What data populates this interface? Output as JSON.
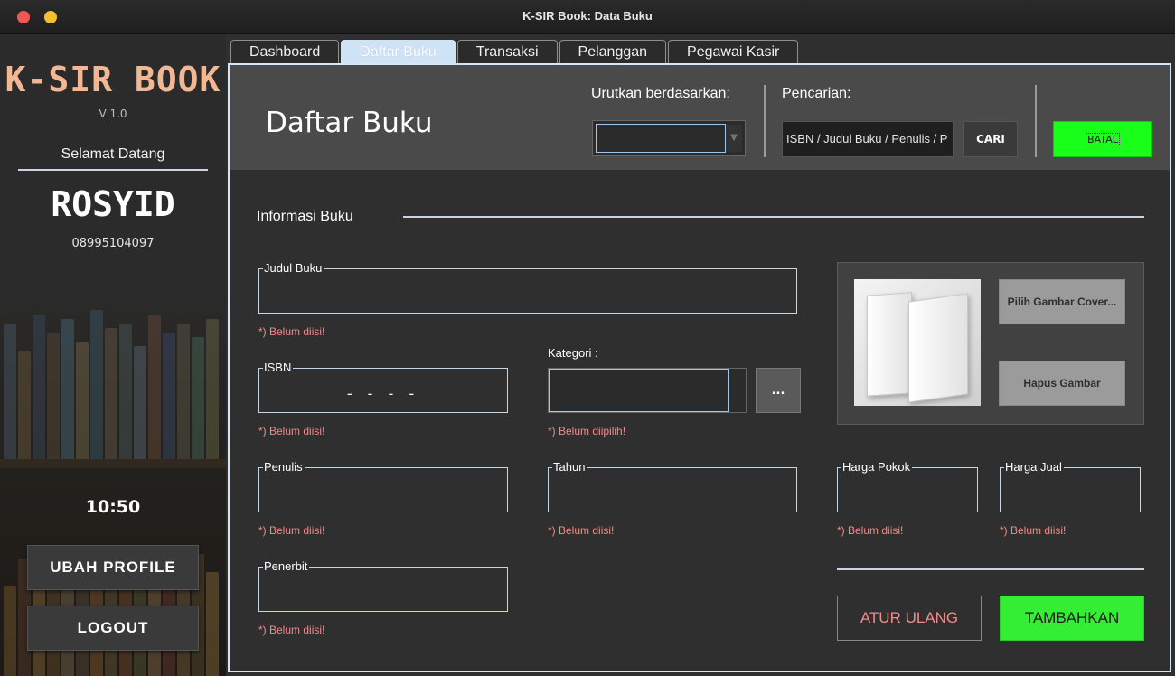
{
  "window": {
    "title": "K-SIR Book: Data Buku"
  },
  "sidebar": {
    "logo": "K-SIR BOOK",
    "version": "V 1.0",
    "welcome": "Selamat Datang",
    "username": "ROSYID",
    "phone": "08995104097",
    "clock": "10:50",
    "profile_button": "UBAH PROFILE",
    "logout_button": "LOGOUT"
  },
  "tabs": [
    {
      "label": "Dashboard",
      "active": false
    },
    {
      "label": "Daftar Buku",
      "active": true
    },
    {
      "label": "Transaksi",
      "active": false
    },
    {
      "label": "Pelanggan",
      "active": false
    },
    {
      "label": "Pegawai Kasir",
      "active": false
    }
  ],
  "header": {
    "title": "Daftar Buku",
    "sort_label": "Urutkan berdasarkan:",
    "sort_value": "",
    "search_label": "Pencarian:",
    "search_value": "ISBN / Judul Buku / Penulis / P",
    "search_button": "CARI",
    "cancel_button": "BATAL"
  },
  "form": {
    "section_title": "Informasi Buku",
    "judul": {
      "label": "Judul Buku",
      "value": "",
      "error": "*) Belum diisi!"
    },
    "isbn": {
      "label": "ISBN",
      "value": "-  -   - -",
      "error": "*) Belum diisi!"
    },
    "kategori": {
      "label": "Kategori :",
      "value": "",
      "button": "...",
      "error": "*) Belum diipilih!"
    },
    "penulis": {
      "label": "Penulis",
      "value": "",
      "error": "*) Belum diisi!"
    },
    "tahun": {
      "label": "Tahun",
      "value": "",
      "error": "*) Belum diisi!"
    },
    "penerbit": {
      "label": "Penerbit",
      "value": "",
      "error": "*) Belum diisi!"
    },
    "harga_pokok": {
      "label": "Harga Pokok",
      "value": "",
      "error": "*) Belum diisi!"
    },
    "harga_jual": {
      "label": "Harga Jual",
      "value": "",
      "error": "*) Belum diisi!"
    },
    "cover": {
      "choose_button": "Pilih Gambar Cover...",
      "remove_button": "Hapus Gambar"
    },
    "reset_button": "ATUR ULANG",
    "add_button": "TAMBAHKAN"
  },
  "colors": {
    "accent_green": "#19ff19",
    "error_red": "#f28a8a",
    "logo_peach": "#f3b893",
    "tab_active": "#cfe3f7"
  }
}
